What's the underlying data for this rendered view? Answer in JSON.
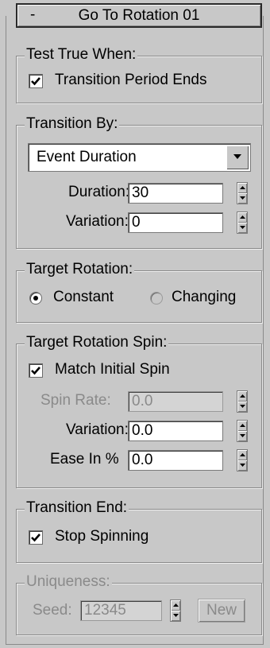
{
  "rollout": {
    "title": "Go To Rotation 01",
    "collapse_symbol": "-"
  },
  "test_true_when": {
    "label": "Test True When:",
    "transition_period_ends": {
      "label": "Transition Period Ends",
      "checked": true
    }
  },
  "transition_by": {
    "label": "Transition By:",
    "dropdown_value": "Event Duration",
    "duration": {
      "label": "Duration:",
      "value": "30"
    },
    "variation": {
      "label": "Variation:",
      "value": "0"
    }
  },
  "target_rotation": {
    "label": "Target Rotation:",
    "options": [
      {
        "label": "Constant",
        "selected": true
      },
      {
        "label": "Changing",
        "selected": false
      }
    ]
  },
  "target_rotation_spin": {
    "label": "Target Rotation Spin:",
    "match_initial_spin": {
      "label": "Match Initial Spin",
      "checked": true
    },
    "spin_rate": {
      "label": "Spin Rate:",
      "value": "0.0",
      "enabled": false
    },
    "variation": {
      "label": "Variation:",
      "value": "0.0"
    },
    "ease_in": {
      "label": "Ease In %",
      "value": "0.0"
    }
  },
  "transition_end": {
    "label": "Transition End:",
    "stop_spinning": {
      "label": "Stop Spinning",
      "checked": true
    }
  },
  "uniqueness": {
    "label": "Uniqueness:",
    "enabled": false,
    "seed": {
      "label": "Seed:",
      "value": "12345"
    },
    "new_button": "New"
  },
  "colors": {
    "panel_bg": "#c8c8c8",
    "disabled_text": "#8a8a8a"
  }
}
